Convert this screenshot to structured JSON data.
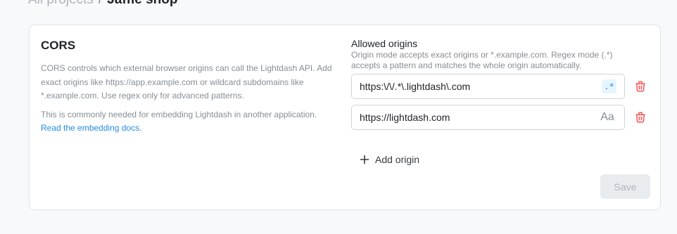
{
  "breadcrumb": {
    "parent": "All projects",
    "separator": "/",
    "current": "Jaffle shop"
  },
  "cors": {
    "title": "CORS",
    "description": "CORS controls which external browser origins can call the Lightdash API. Add exact origins like https://app.example.com or wildcard subdomains like *.example.com. Use regex only for advanced patterns.",
    "note": "This is commonly needed for embedding Lightdash in another application.",
    "docs_link": "Read the embedding docs."
  },
  "allowed_origins": {
    "label": "Allowed origins",
    "description": "Origin mode accepts exact origins or *.example.com. Regex mode (.*) accepts a pattern and matches the whole origin automatically.",
    "origins": [
      {
        "value": "https:\\/\\/.*\\.lightdash\\.com",
        "mode_label": ".*",
        "mode_icon": "regex-mode-icon"
      },
      {
        "value": "https://lightdash.com",
        "mode_label": "Aa",
        "mode_icon": "exact-mode-icon"
      }
    ],
    "add_label": "Add origin"
  },
  "actions": {
    "save_label": "Save"
  },
  "colors": {
    "link": "#228be6",
    "delete": "#fa5252",
    "muted": "#868e96"
  }
}
